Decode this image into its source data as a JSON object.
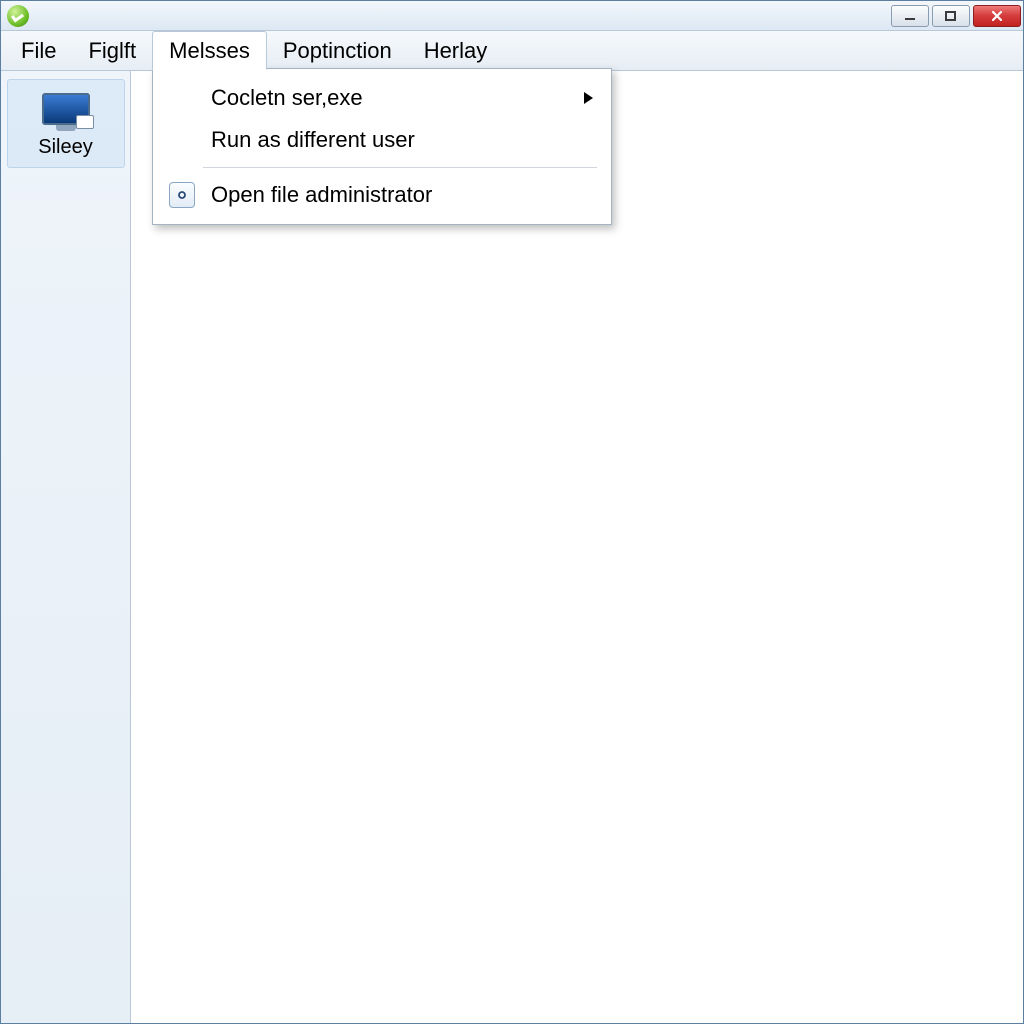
{
  "menubar": {
    "items": [
      {
        "label": "File"
      },
      {
        "label": "Figlft"
      },
      {
        "label": "Melsses",
        "open": true
      },
      {
        "label": "Poptinction"
      },
      {
        "label": "Herlay"
      }
    ]
  },
  "sidebar": {
    "items": [
      {
        "label": "Sileey",
        "icon": "monitor-icon"
      }
    ]
  },
  "dropdown": {
    "items": [
      {
        "label": "Cocletn ser,exe",
        "has_submenu": true
      },
      {
        "label": "Run as different user"
      }
    ],
    "after_sep": [
      {
        "label": "Open file administrator",
        "icon": "link-icon"
      }
    ]
  },
  "window_controls": {
    "minimize": "minimize",
    "maximize": "maximize",
    "close": "close"
  }
}
